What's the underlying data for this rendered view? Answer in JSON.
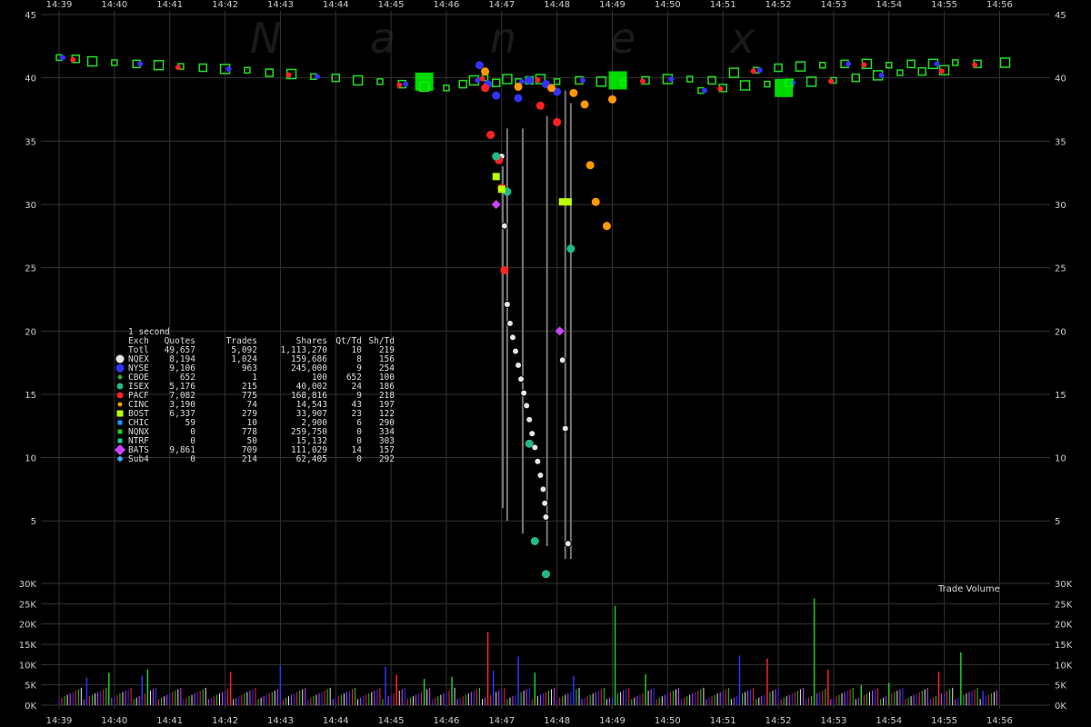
{
  "watermark": "Nanex",
  "colors": {
    "background": "#000000",
    "grid": "#333333",
    "axis_text": "#cccccc",
    "bid_ask_outline": "#22dd22",
    "quote_fill": "#00ff00",
    "panel_bg": "#333333",
    "watermark": "#1a1a1a",
    "NQEX": "#e6e6e6",
    "NYSE": "#3333ff",
    "CBOE": "#33aa33",
    "ISEX": "#22bb88",
    "PACF": "#ff2222",
    "CINC": "#ff9900",
    "BOST": "#bbff00",
    "CHIC": "#2299ff",
    "NQNX": "#22cc22",
    "NTRF": "#22cc99",
    "BATS": "#cc44ff",
    "Sub4": "#44aaff"
  },
  "chart_data": [
    {
      "type": "scatter",
      "panel": "price",
      "x_tick_labels": [
        "14:39",
        "14:40",
        "14:41",
        "14:42",
        "14:43",
        "14:44",
        "14:45",
        "14:46",
        "14:47",
        "14:48",
        "14:49",
        "14:50",
        "14:51",
        "14:52",
        "14:53",
        "14:54",
        "14:55",
        "14:56"
      ],
      "y_tick_labels": [
        "45",
        "40",
        "35",
        "30",
        "25",
        "20",
        "15",
        "10",
        "5"
      ],
      "ylim": [
        2.5,
        45
      ],
      "series": [
        {
          "name": "quotes",
          "x": [
            0,
            0.3,
            0.6,
            1,
            1.4,
            1.8,
            2.2,
            2.6,
            3,
            3.4,
            3.8,
            4.2,
            4.6,
            5,
            5.4,
            5.8,
            6.2,
            6.6,
            7,
            7.3,
            7.5,
            7.7,
            7.9,
            8.1,
            8.3,
            8.5,
            8.7,
            9,
            9.4,
            9.8,
            10.2,
            10.6,
            11,
            11.4,
            11.8,
            12.2,
            12.6,
            13,
            13.4,
            13.8,
            14.2,
            14.6,
            15,
            15.4,
            15.8,
            16.2,
            16.6,
            17.1
          ],
          "y": [
            41.6,
            41.5,
            41.3,
            41.2,
            41.1,
            41.0,
            40.9,
            40.8,
            40.7,
            40.6,
            40.4,
            40.3,
            40.1,
            40.0,
            39.8,
            39.7,
            39.5,
            39.3,
            39.2,
            39.5,
            39.8,
            40.0,
            39.6,
            39.9,
            39.7,
            39.8,
            39.9,
            39.7,
            39.8,
            39.7,
            39.6,
            39.8,
            39.9,
            39.9,
            39.8,
            40.4,
            40.6,
            40.8,
            40.9,
            41.0,
            41.1,
            41.1,
            41.0,
            41.1,
            41.1,
            41.2,
            41.1,
            41.2
          ]
        },
        {
          "name": "lower_quotes",
          "x": [
            11.6,
            12.0,
            12.4,
            12.8,
            13.2,
            13.6,
            14.0,
            14.4,
            14.8,
            15.2,
            15.6,
            16.0
          ],
          "y": [
            39.0,
            39.2,
            39.4,
            39.5,
            39.6,
            39.7,
            39.8,
            40.0,
            40.2,
            40.4,
            40.5,
            40.6
          ]
        },
        {
          "name": "NQEX",
          "x": [
            8.0,
            8.05,
            8.1,
            8.15,
            8.2,
            8.25,
            8.3,
            8.35,
            8.4,
            8.45,
            8.5,
            8.55,
            8.6,
            8.65,
            8.7,
            8.75,
            8.78,
            8.8,
            9.1,
            9.15,
            9.2
          ],
          "y": [
            33.8,
            28.3,
            22.1,
            20.6,
            19.5,
            18.4,
            17.3,
            16.2,
            15.1,
            14.1,
            13.0,
            11.9,
            10.8,
            9.7,
            8.6,
            7.5,
            6.4,
            5.3,
            17.7,
            12.3,
            3.2
          ]
        },
        {
          "name": "NYSE",
          "x": [
            7.6,
            7.75,
            7.9,
            8.3,
            8.5,
            8.8,
            9.0
          ],
          "y": [
            41.0,
            39.5,
            38.6,
            38.4,
            39.8,
            39.5,
            38.9
          ]
        },
        {
          "name": "PACF",
          "x": [
            7.7,
            7.8,
            7.95,
            8.0,
            8.05,
            8.7,
            9.0
          ],
          "y": [
            39.2,
            35.5,
            33.5,
            31.3,
            24.8,
            37.8,
            36.5
          ]
        },
        {
          "name": "CINC",
          "x": [
            7.7,
            8.3,
            8.9,
            9.3,
            9.5,
            9.6,
            9.7,
            9.9,
            10.0
          ],
          "y": [
            40.5,
            39.3,
            39.2,
            38.8,
            37.9,
            33.1,
            30.2,
            28.3,
            38.3
          ]
        },
        {
          "name": "ISEX",
          "x": [
            7.9,
            8.1,
            8.5,
            8.6,
            8.8,
            9.25
          ],
          "y": [
            33.8,
            31.0,
            11.1,
            3.4,
            0.8,
            26.5
          ]
        },
        {
          "name": "BOST",
          "x": [
            7.9,
            8.0,
            9.1,
            9.2
          ],
          "y": [
            32.2,
            31.2,
            30.2,
            30.2
          ]
        },
        {
          "name": "BATS",
          "x": [
            7.9,
            9.05
          ],
          "y": [
            30.0,
            20.0
          ]
        }
      ]
    },
    {
      "type": "bar",
      "panel": "volume",
      "title": "Trade Volume",
      "y_tick_labels": [
        "30K",
        "25K",
        "20K",
        "15K",
        "10K",
        "5K",
        "0K"
      ],
      "ylim": [
        0,
        30000
      ],
      "bars": [
        {
          "t": 0.5,
          "v": 6800,
          "c": "NYSE"
        },
        {
          "t": 0.9,
          "v": 8000,
          "c": "NQNX"
        },
        {
          "t": 1.5,
          "v": 7300,
          "c": "NYSE"
        },
        {
          "t": 1.6,
          "v": 8800,
          "c": "NQNX"
        },
        {
          "t": 3.1,
          "v": 8200,
          "c": "PACF"
        },
        {
          "t": 4.0,
          "v": 9800,
          "c": "NYSE"
        },
        {
          "t": 5.9,
          "v": 9500,
          "c": "NYSE"
        },
        {
          "t": 6.1,
          "v": 7500,
          "c": "PACF"
        },
        {
          "t": 6.6,
          "v": 6500,
          "c": "NQNX"
        },
        {
          "t": 7.1,
          "v": 7000,
          "c": "NQNX"
        },
        {
          "t": 7.75,
          "v": 18000,
          "c": "PACF"
        },
        {
          "t": 7.85,
          "v": 8500,
          "c": "NYSE"
        },
        {
          "t": 8.3,
          "v": 12000,
          "c": "NYSE"
        },
        {
          "t": 8.6,
          "v": 8000,
          "c": "NQNX"
        },
        {
          "t": 9.3,
          "v": 7200,
          "c": "NYSE"
        },
        {
          "t": 10.05,
          "v": 24500,
          "c": "NQNX"
        },
        {
          "t": 10.6,
          "v": 7600,
          "c": "NQNX"
        },
        {
          "t": 12.3,
          "v": 12200,
          "c": "NYSE"
        },
        {
          "t": 12.8,
          "v": 11500,
          "c": "PACF"
        },
        {
          "t": 13.65,
          "v": 26300,
          "c": "NQNX"
        },
        {
          "t": 13.9,
          "v": 8800,
          "c": "PACF"
        },
        {
          "t": 14.5,
          "v": 5000,
          "c": "NQNX"
        },
        {
          "t": 15.0,
          "v": 5500,
          "c": "NQNX"
        },
        {
          "t": 15.9,
          "v": 8300,
          "c": "PACF"
        },
        {
          "t": 16.3,
          "v": 13000,
          "c": "NQNX"
        },
        {
          "t": 16.7,
          "v": 3500,
          "c": "NYSE"
        }
      ]
    }
  ],
  "legend": {
    "caption": "1 second",
    "headers": [
      "Exch",
      "Quotes",
      "Trades",
      "Shares",
      "Qt/Td",
      "Sh/Td"
    ],
    "total": [
      "Totl",
      "49,657",
      "5,092",
      "1,113,270",
      "10",
      "219"
    ],
    "rows": [
      {
        "exch": "NQEX",
        "quotes": "8,194",
        "trades": "1,024",
        "shares": "159,686",
        "qttd": "8",
        "shtd": "156",
        "color": "#e6e6e6",
        "marker": "big-circle"
      },
      {
        "exch": "NYSE",
        "quotes": "9,106",
        "trades": "963",
        "shares": "245,000",
        "qttd": "9",
        "shtd": "254",
        "color": "#3333ff",
        "marker": "big-circle"
      },
      {
        "exch": "CBOE",
        "quotes": "652",
        "trades": "1",
        "shares": "100",
        "qttd": "652",
        "shtd": "100",
        "color": "#33aa33",
        "marker": "small-circle"
      },
      {
        "exch": "ISEX",
        "quotes": "5,176",
        "trades": "215",
        "shares": "40,002",
        "qttd": "24",
        "shtd": "186",
        "color": "#22bb88",
        "marker": "circle"
      },
      {
        "exch": "PACF",
        "quotes": "7,082",
        "trades": "775",
        "shares": "168,816",
        "qttd": "9",
        "shtd": "218",
        "color": "#ff2222",
        "marker": "circle"
      },
      {
        "exch": "CINC",
        "quotes": "3,190",
        "trades": "74",
        "shares": "14,543",
        "qttd": "43",
        "shtd": "197",
        "color": "#ff9900",
        "marker": "small-circle"
      },
      {
        "exch": "BOST",
        "quotes": "6,337",
        "trades": "279",
        "shares": "33,907",
        "qttd": "23",
        "shtd": "122",
        "color": "#bbff00",
        "marker": "square"
      },
      {
        "exch": "CHIC",
        "quotes": "59",
        "trades": "10",
        "shares": "2,900",
        "qttd": "6",
        "shtd": "290",
        "color": "#2299ff",
        "marker": "small-square"
      },
      {
        "exch": "NQNX",
        "quotes": "0",
        "trades": "778",
        "shares": "259,750",
        "qttd": "0",
        "shtd": "334",
        "color": "#22cc22",
        "marker": "small-square"
      },
      {
        "exch": "NTRF",
        "quotes": "0",
        "trades": "50",
        "shares": "15,132",
        "qttd": "0",
        "shtd": "303",
        "color": "#22cc99",
        "marker": "small-square"
      },
      {
        "exch": "BATS",
        "quotes": "9,861",
        "trades": "709",
        "shares": "111,029",
        "qttd": "14",
        "shtd": "157",
        "color": "#cc44ff",
        "marker": "diamond"
      },
      {
        "exch": "Sub4",
        "quotes": "0",
        "trades": "214",
        "shares": "62,405",
        "qttd": "0",
        "shtd": "292",
        "color": "#44aaff",
        "marker": "small-diamond"
      }
    ]
  }
}
